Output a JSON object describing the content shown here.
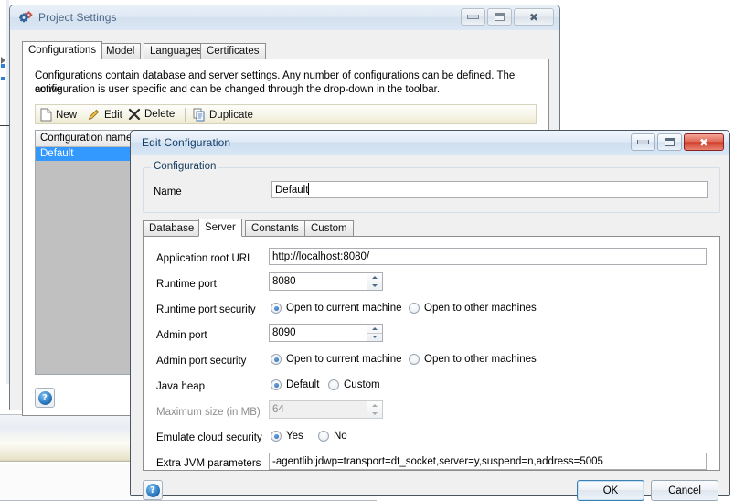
{
  "background_window": {
    "title": "Project Settings",
    "icon": "gears-icon",
    "caption_buttons": {
      "minimize": "minimize-icon",
      "maximize": "maximize-icon",
      "close": "close-icon"
    },
    "tabs": [
      {
        "label": "Configurations",
        "selected": true
      },
      {
        "label": "Model",
        "selected": false
      },
      {
        "label": "Languages",
        "selected": false
      },
      {
        "label": "Certificates",
        "selected": false
      }
    ],
    "description_line1": "Configurations contain database and server settings. Any number of configurations can be defined. The active",
    "description_line2": "configuration is user specific and can be changed through the drop-down in the toolbar.",
    "toolbar": [
      {
        "label": "New",
        "icon": "new-page-icon"
      },
      {
        "label": "Edit",
        "icon": "pencil-icon"
      },
      {
        "label": "Delete",
        "icon": "x-mark-icon"
      },
      {
        "label": "Duplicate",
        "icon": "duplicate-pages-icon"
      }
    ],
    "list": {
      "columns": [
        "Configuration name"
      ],
      "rows": [
        {
          "name": "Default",
          "selected": true
        }
      ]
    },
    "help_button": {
      "label": "?",
      "name": "help-button"
    }
  },
  "dialog": {
    "title": "Edit Configuration",
    "caption_buttons": {
      "minimize": "minimize-icon",
      "maximize": "maximize-icon",
      "close": "close-icon"
    },
    "group": {
      "title": "Configuration",
      "name_label": "Name",
      "name_value": "Default"
    },
    "tabs": [
      {
        "label": "Database",
        "selected": false
      },
      {
        "label": "Server",
        "selected": true
      },
      {
        "label": "Constants",
        "selected": false
      },
      {
        "label": "Custom",
        "selected": false
      }
    ],
    "fields": {
      "app_root_url": {
        "label": "Application root URL",
        "value": "http://localhost:8080/"
      },
      "runtime_port": {
        "label": "Runtime port",
        "value": "8080"
      },
      "runtime_port_security": {
        "label": "Runtime port security",
        "options": [
          {
            "label": "Open to current machine",
            "selected": true
          },
          {
            "label": "Open to other machines",
            "selected": false
          }
        ]
      },
      "admin_port": {
        "label": "Admin port",
        "value": "8090"
      },
      "admin_port_security": {
        "label": "Admin port security",
        "options": [
          {
            "label": "Open to current machine",
            "selected": true
          },
          {
            "label": "Open to other machines",
            "selected": false
          }
        ]
      },
      "java_heap": {
        "label": "Java heap",
        "options": [
          {
            "label": "Default",
            "selected": true
          },
          {
            "label": "Custom",
            "selected": false
          }
        ]
      },
      "maximum_size": {
        "label": "Maximum size (in MB)",
        "value": "64",
        "disabled": true
      },
      "emulate_cloud_security": {
        "label": "Emulate cloud security",
        "options": [
          {
            "label": "Yes",
            "selected": true
          },
          {
            "label": "No",
            "selected": false
          }
        ]
      },
      "extra_jvm": {
        "label": "Extra JVM parameters",
        "value": "-agentlib:jdwp=transport=dt_socket,server=y,suspend=n,address=5005"
      }
    },
    "footer": {
      "help_label": "?",
      "ok_label": "OK",
      "cancel_label": "Cancel"
    }
  },
  "colors": {
    "selection_blue": "#3399ff",
    "title_text": "#16406c",
    "close_red": "#cf3f2c",
    "default_button_border": "#3c7fb1",
    "list_empty_gray": "#c0c0c0"
  }
}
